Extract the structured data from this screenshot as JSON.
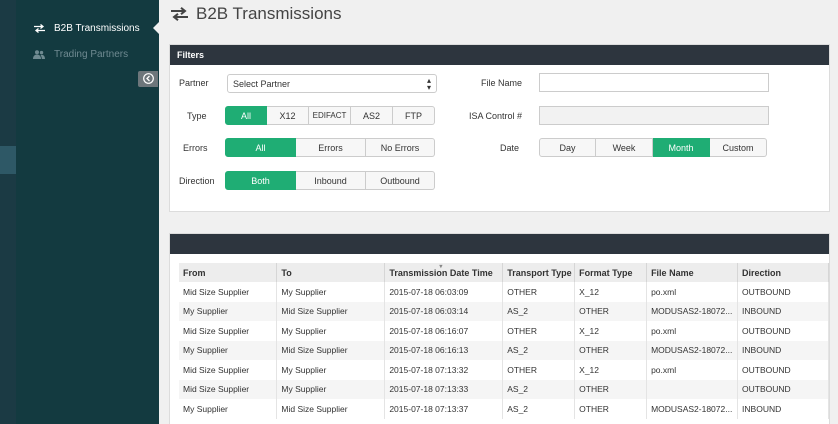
{
  "sidebar": {
    "items": [
      {
        "label": "B2B Transmissions",
        "icon": "transfer-arrows-icon",
        "active": true
      },
      {
        "label": "Trading Partners",
        "icon": "users-icon",
        "active": false
      }
    ],
    "collapse_icon": "collapse-left-icon"
  },
  "header": {
    "title": "B2B Transmissions",
    "icon": "transfer-arrows-icon"
  },
  "filters": {
    "title": "Filters",
    "partner": {
      "label": "Partner",
      "value": "Select Partner"
    },
    "type": {
      "label": "Type",
      "options": [
        "All",
        "X12",
        "EDIFACT",
        "AS2",
        "FTP"
      ],
      "selected": "All"
    },
    "errors": {
      "label": "Errors",
      "options": [
        "All",
        "Errors",
        "No Errors"
      ],
      "selected": "All"
    },
    "direction": {
      "label": "Direction",
      "options": [
        "Both",
        "Inbound",
        "Outbound"
      ],
      "selected": "Both"
    },
    "file_name": {
      "label": "File Name",
      "value": ""
    },
    "isa_control": {
      "label": "ISA Control #",
      "value": ""
    },
    "date": {
      "label": "Date",
      "options": [
        "Day",
        "Week",
        "Month",
        "Custom"
      ],
      "selected": "Month"
    }
  },
  "table": {
    "columns": [
      "From",
      "To",
      "Transmission Date Time",
      "Transport Type",
      "Format Type",
      "File Name",
      "Direction"
    ],
    "rows": [
      [
        "Mid Size Supplier",
        "My Supplier",
        "2015-07-18 06:03:09",
        "OTHER",
        "X_12",
        "po.xml",
        "OUTBOUND"
      ],
      [
        "My Supplier",
        "Mid Size Supplier",
        "2015-07-18 06:03:14",
        "AS_2",
        "OTHER",
        "MODUSAS2-18072...",
        "INBOUND"
      ],
      [
        "Mid Size Supplier",
        "My Supplier",
        "2015-07-18 06:16:07",
        "OTHER",
        "X_12",
        "po.xml",
        "OUTBOUND"
      ],
      [
        "My Supplier",
        "Mid Size Supplier",
        "2015-07-18 06:16:13",
        "AS_2",
        "OTHER",
        "MODUSAS2-18072...",
        "INBOUND"
      ],
      [
        "Mid Size Supplier",
        "My Supplier",
        "2015-07-18 07:13:32",
        "OTHER",
        "X_12",
        "po.xml",
        "OUTBOUND"
      ],
      [
        "Mid Size Supplier",
        "My Supplier",
        "2015-07-18 07:13:33",
        "AS_2",
        "OTHER",
        "",
        "OUTBOUND"
      ],
      [
        "My Supplier",
        "Mid Size Supplier",
        "2015-07-18 07:13:37",
        "AS_2",
        "OTHER",
        "MODUSAS2-18072...",
        "INBOUND"
      ]
    ]
  },
  "colors": {
    "accent": "#1fad74",
    "sidebar": "#133a40",
    "panel_header": "#2d353e"
  }
}
